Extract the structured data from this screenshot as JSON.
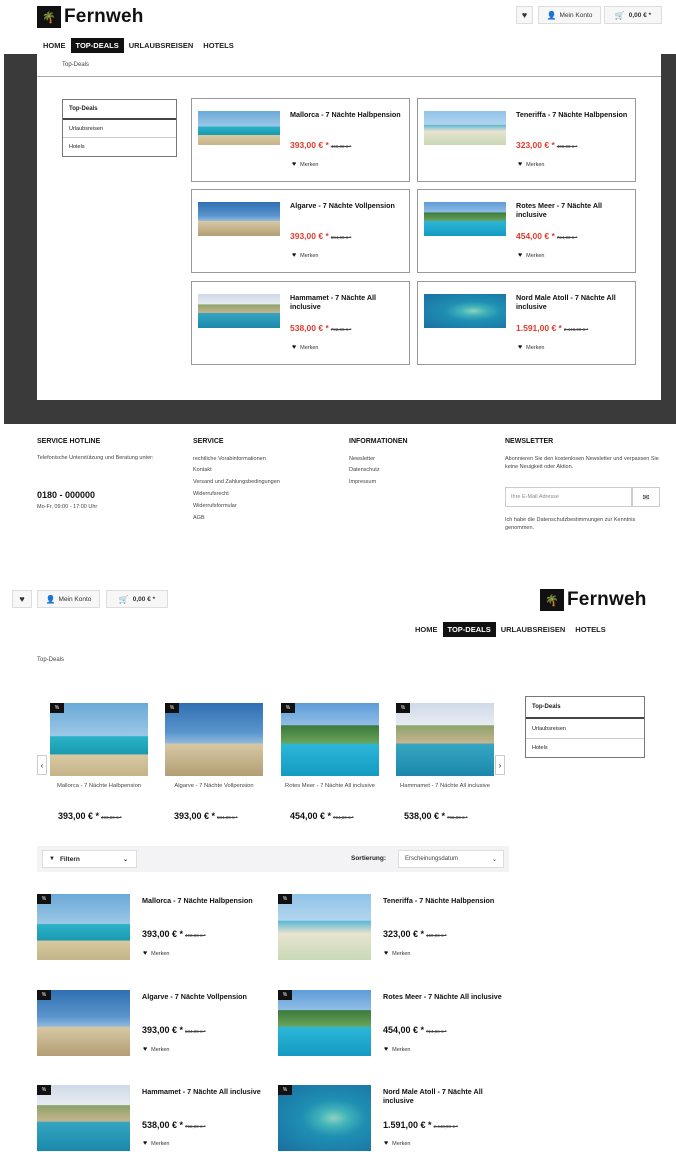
{
  "brand": {
    "name": "Fernweh",
    "logo_icon": "palm-icon"
  },
  "header": {
    "wishlist_icon": "heart-icon",
    "account_label": "Mein Konto",
    "cart_label": "0,00 € *"
  },
  "nav": {
    "items": [
      "HOME",
      "TOP-DEALS",
      "URLAUBSREISEN",
      "HOTELS"
    ],
    "active": "TOP-DEALS"
  },
  "breadcrumb": "Top-Deals",
  "sidebar": {
    "items": [
      "Top-Deals",
      "Urlaubsreisen",
      "Hotels"
    ]
  },
  "products": [
    {
      "title": "Mallorca - 7 Nächte Halbpension",
      "price": "393,00 € *",
      "old": "490,00 € *",
      "merken": "Merken"
    },
    {
      "title": "Teneriffa - 7 Nächte Halbpension",
      "price": "323,00 € *",
      "old": "400,00 € *",
      "merken": "Merken"
    },
    {
      "title": "Algarve - 7 Nächte Vollpension",
      "price": "393,00 € *",
      "old": "584,00 € *",
      "merken": "Merken"
    },
    {
      "title": "Rotes Meer - 7 Nächte All inclusive",
      "price": "454,00 € *",
      "old": "724,00 € *",
      "merken": "Merken"
    },
    {
      "title": "Hammamet - 7 Nächte All inclusive",
      "price": "538,00 € *",
      "old": "792,00 € *",
      "merken": "Merken"
    },
    {
      "title": "Nord Male Atoll - 7 Nächte All inclusive",
      "price": "1.591,00 € *",
      "old": "2.443,00 € *",
      "merken": "Merken"
    }
  ],
  "footer": {
    "hotline_title": "SERVICE HOTLINE",
    "hotline_text": "Telefonische Unterstützung und Beratung unter:",
    "hotline_number": "0180 - 000000",
    "hotline_hours": "Mo-Fr, 09:00 - 17:00 Uhr",
    "service_title": "SERVICE",
    "service_links": [
      "rechtliche Vorabinformationen",
      "Kontakt",
      "Versand und Zahlungsbedingungen",
      "Widerrufsrecht",
      "Widerrufsformular",
      "AGB"
    ],
    "info_title": "INFORMATIONEN",
    "info_links": [
      "Newsletter",
      "Datenschutz",
      "Impressum"
    ],
    "newsletter_title": "NEWSLETTER",
    "newsletter_text": "Abonnieren Sie den kostenlosen Newsletter und verpassen Sie keine Neuigkeit oder Aktion.",
    "newsletter_placeholder": "Ihre E-Mail Adresse",
    "newsletter_consent": "Ich habe die Datenschutzbestimmungen zur Kenntnis genommen."
  },
  "carousel": {
    "items": [
      {
        "name": "Mallorca - 7 Nächte Halbpension",
        "price": "393,00 € *",
        "old": "490,00 € *"
      },
      {
        "name": "Algarve - 7 Nächte Vollpension",
        "price": "393,00 € *",
        "old": "584,00 € *"
      },
      {
        "name": "Rotes Meer - 7 Nächte All inclusive",
        "price": "454,00 € *",
        "old": "724,00 € *"
      },
      {
        "name": "Hammamet - 7 Nächte All inclusive",
        "price": "538,00 € *",
        "old": "792,00 € *"
      }
    ]
  },
  "filter": {
    "label": "Filtern",
    "sort_label": "Sortierung:",
    "sort_value": "Erscheinungsdatum"
  },
  "listing2": [
    {
      "title": "Mallorca - 7 Nächte Halbpension",
      "price": "393,00 € *",
      "old": "490,00 € *",
      "merken": "Merken"
    },
    {
      "title": "Teneriffa - 7 Nächte Halbpension",
      "price": "323,00 € *",
      "old": "400,00 € *",
      "merken": "Merken"
    },
    {
      "title": "Algarve - 7 Nächte Vollpension",
      "price": "393,00 € *",
      "old": "584,00 € *",
      "merken": "Merken"
    },
    {
      "title": "Rotes Meer - 7 Nächte All inclusive",
      "price": "454,00 € *",
      "old": "724,00 € *",
      "merken": "Merken"
    },
    {
      "title": "Hammamet - 7 Nächte All inclusive",
      "price": "538,00 € *",
      "old": "792,00 € *",
      "merken": "Merken"
    },
    {
      "title": "Nord Male Atoll - 7 Nächte All inclusive",
      "price": "1.591,00 € *",
      "old": "2.443,00 € *",
      "merken": "Merken"
    }
  ]
}
